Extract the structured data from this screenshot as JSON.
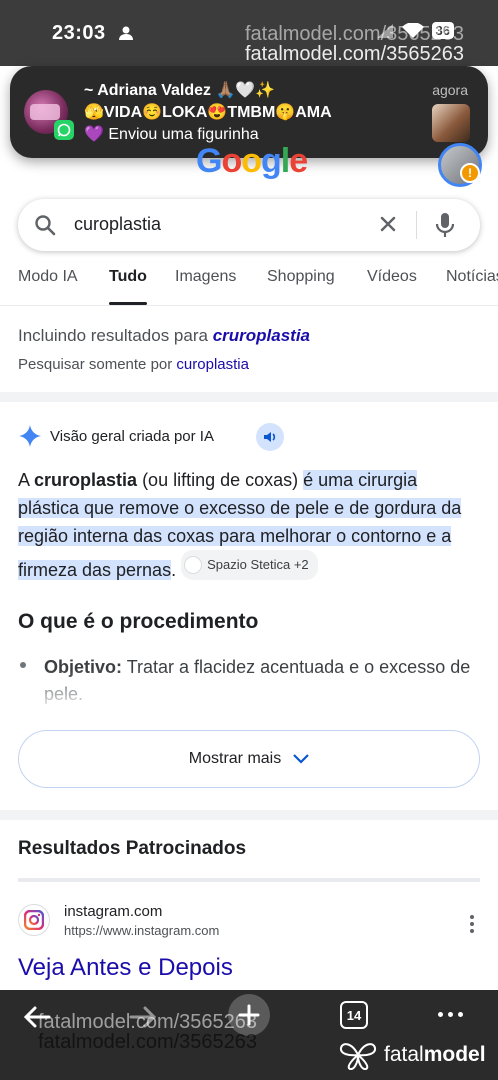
{
  "status_bar": {
    "time": "23:03",
    "battery": "36"
  },
  "watermark": {
    "text": "fatalmodel.com/3565263",
    "brand_light": "fatal",
    "brand_bold": "model"
  },
  "notification": {
    "sender": "~ Adriana Valdez 🙏🏽🤍✨",
    "status": "🫣VIDA☺️LOKA😍TMBM🤫AMA",
    "message": "💜 Enviou uma figurinha",
    "time": "agora"
  },
  "google": {
    "logo": [
      "G",
      "o",
      "o",
      "g",
      "l",
      "e"
    ],
    "search_query": "curoplastia"
  },
  "tabs": [
    {
      "label": "Modo IA",
      "active": false
    },
    {
      "label": "Tudo",
      "active": true
    },
    {
      "label": "Imagens",
      "active": false
    },
    {
      "label": "Shopping",
      "active": false
    },
    {
      "label": "Vídeos",
      "active": false
    },
    {
      "label": "Notícias",
      "active": false
    }
  ],
  "spelling": {
    "including_prefix": "Incluindo resultados para ",
    "corrected_term": "cruroplastia",
    "search_only_prefix": "Pesquisar somente por ",
    "original_term": "curoplastia"
  },
  "ai_overview": {
    "header": "Visão geral criada por IA",
    "body_a": "A ",
    "body_term": "cruroplastia",
    "body_paren": " (ou lifting de coxas) ",
    "body_highlight": "é uma cirurgia plástica que remove o excesso de pele e de gordura da região interna das coxas para melhorar o contorno e a firmeza das pernas",
    "body_end": ".",
    "source_chip": "Spazio Stetica +2",
    "section_title": "O que é o procedimento",
    "bullet_label": "Objetivo:",
    "bullet_text": " Tratar a flacidez acentuada e o excesso de pele.",
    "show_more": "Mostrar mais"
  },
  "sponsored": {
    "title": "Resultados Patrocinados",
    "domain": "instagram.com",
    "url": "https://www.instagram.com",
    "ad_title": "Veja Antes e Depois"
  },
  "bottom_nav": {
    "tab_count": "14"
  }
}
